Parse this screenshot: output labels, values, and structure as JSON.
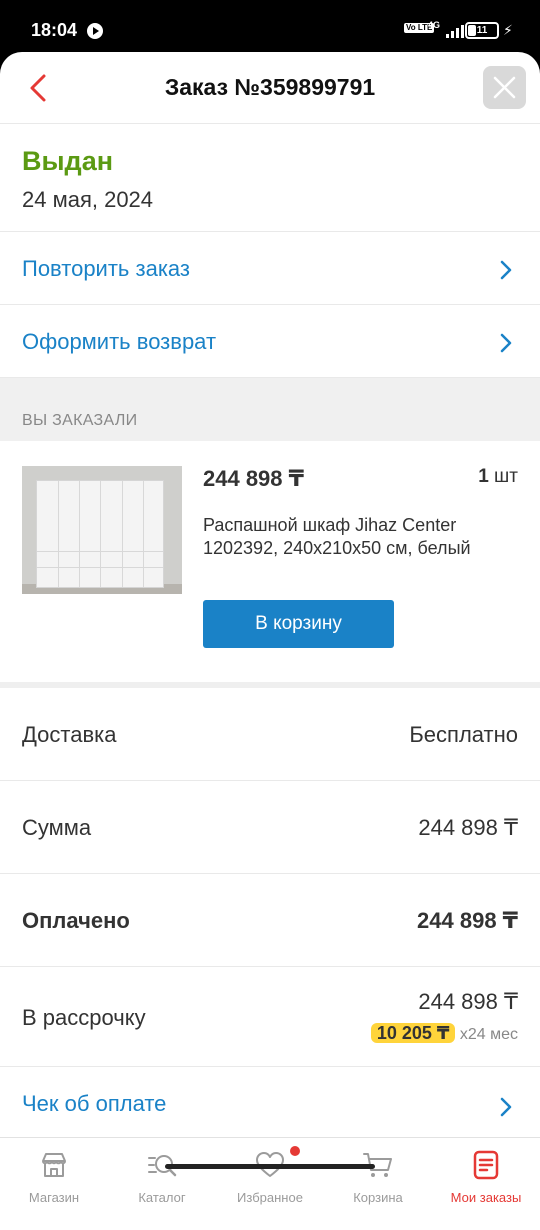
{
  "status_bar": {
    "time": "18:04",
    "volte": "Vo LTE",
    "network": "4G",
    "battery": "11"
  },
  "header": {
    "title": "Заказ №359899791",
    "back_icon": "chevron-left-icon",
    "close_icon": "close-icon"
  },
  "order": {
    "status": "Выдан",
    "status_color": "#5b9a13",
    "date": "24 мая, 2024"
  },
  "actions": [
    {
      "label": "Повторить заказ"
    },
    {
      "label": "Оформить возврат"
    }
  ],
  "ordered_section": {
    "title": "ВЫ ЗАКАЗАЛИ"
  },
  "product": {
    "price": "244 898 ₸",
    "qty_num": "1",
    "qty_unit": "шт",
    "name": "Распашной шкаф Jihaz Center 1202392, 240x210x50 см, белый",
    "cart_button": "В корзину"
  },
  "summary": {
    "delivery_label": "Доставка",
    "delivery_value": "Бесплатно",
    "sum_label": "Сумма",
    "sum_value": "244 898 ₸",
    "paid_label": "Оплачено",
    "paid_value": "244 898 ₸",
    "installment_label": "В рассрочку",
    "installment_value": "244 898 ₸",
    "installment_monthly": "10 205 ₸",
    "installment_term": "x24 мес"
  },
  "receipt": {
    "label": "Чек об оплате"
  },
  "tabbar": {
    "items": [
      {
        "label": "Магазин",
        "icon": "shop-icon"
      },
      {
        "label": "Каталог",
        "icon": "catalog-search-icon"
      },
      {
        "label": "Избранное",
        "icon": "heart-icon"
      },
      {
        "label": "Корзина",
        "icon": "cart-icon"
      },
      {
        "label": "Мои заказы",
        "icon": "orders-icon"
      }
    ],
    "active": "Мои заказы"
  },
  "colors": {
    "accent_blue": "#1a82c7",
    "accent_red": "#e53935",
    "badge_yellow": "#ffd43b"
  }
}
